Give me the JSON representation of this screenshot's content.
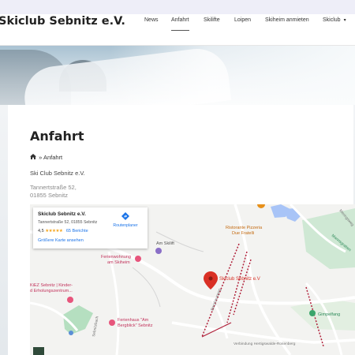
{
  "header": {
    "brand": "Skiclub Sebnitz e.V.",
    "nav": [
      "News",
      "Anfahrt",
      "Skilifte",
      "Loipen",
      "Skiheim anmieten",
      "Skiclub"
    ],
    "active_nav": "Anfahrt",
    "dropdown_caret": "▾"
  },
  "page": {
    "title": "Anfahrt",
    "breadcrumb_separator": "»",
    "breadcrumb_current": "Anfahrt",
    "org_name": "Ski Club Sebnitz e.V.",
    "address_line1": "Tannertstraße 52,",
    "address_line2": "01855 Sebnitz"
  },
  "map": {
    "infobox": {
      "title": "Skiclub Sebnitz e.V.",
      "address": "Tannertstraße 52, 01855 Sebnitz",
      "rating": "4,5",
      "stars": "★★★★★",
      "reviews": "65 Berichte",
      "larger_map": "Größere Karte ansehen",
      "route_label": "Routenplaner"
    },
    "labels": {
      "restaurant": "Ristorante Pizzeria",
      "restaurant2": "Due Fratelli",
      "skilift": "Am Skilift",
      "ferienwohnung1": "Ferienwohnung",
      "ferienwohnung2": "am Skiheim",
      "pin": "Skiclub Sebnitz e.V",
      "kiez1": "KiEZ Sebnitz | Kinder-",
      "kiez2": "d Erholungszentrum...",
      "ferienhaus1": "Ferienhaus \"Am",
      "ferienhaus2": "Bergblick\" Sebnitz",
      "gimpelfang": "Gimpelfang",
      "mannsgraben": "Mannsgraben",
      "meringsweg": "Meringsweg",
      "berghausweg": "Berghausweg",
      "verbindung": "Verbindung Hertigswalde-Rosenberg",
      "sebnitzbach": "Sebnitzbach"
    },
    "colors": {
      "water": "#a8c4f7",
      "park": "#cfe8d4",
      "road": "#ffffff",
      "trail": "#b0203a",
      "pin": "#d93025",
      "poi_pink": "#e7557c",
      "poi_purple": "#8a6fc7",
      "restaurant": "#e7901a",
      "green_text": "#2e8a5a"
    }
  }
}
